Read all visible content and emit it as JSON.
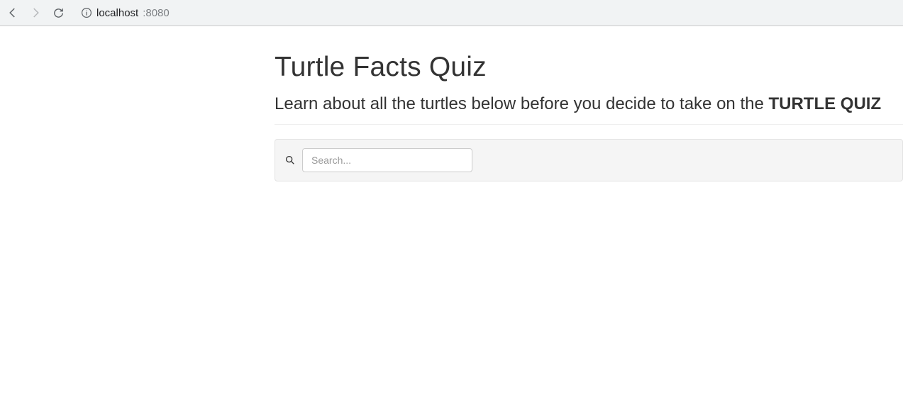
{
  "chrome": {
    "url_host": "localhost",
    "url_port": ":8080"
  },
  "header": {
    "title": "Turtle Facts Quiz",
    "subtitle_lead": "Learn about all the turtles below before you decide to take on the ",
    "subtitle_strong": "TURTLE QUIZ"
  },
  "search": {
    "placeholder": "Search...",
    "value": ""
  }
}
